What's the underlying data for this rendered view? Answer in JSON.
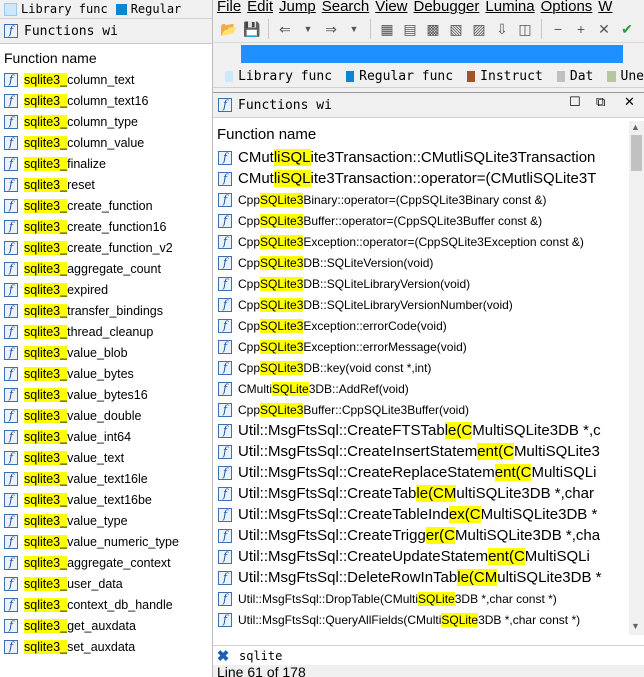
{
  "left": {
    "legend": [
      {
        "label": "Library func",
        "color": "#cce8ff"
      },
      {
        "label": "Regular",
        "color": "#0a86d6"
      }
    ],
    "tab_title": "Functions wi",
    "column_header": "Function name",
    "rows": [
      {
        "hl": "sqlite3_",
        "rest": "column_text"
      },
      {
        "hl": "sqlite3_",
        "rest": "column_text16"
      },
      {
        "hl": "sqlite3_",
        "rest": "column_type"
      },
      {
        "hl": "sqlite3_",
        "rest": "column_value"
      },
      {
        "hl": "sqlite3_",
        "rest": "finalize"
      },
      {
        "hl": "sqlite3_",
        "rest": "reset"
      },
      {
        "hl": "sqlite3_",
        "rest": "create_function"
      },
      {
        "hl": "sqlite3_",
        "rest": "create_function16"
      },
      {
        "hl": "sqlite3_",
        "rest": "create_function_v2"
      },
      {
        "hl": "sqlite3_",
        "rest": "aggregate_count"
      },
      {
        "hl": "sqlite3_",
        "rest": "expired"
      },
      {
        "hl": "sqlite3_",
        "rest": "transfer_bindings"
      },
      {
        "hl": "sqlite3_",
        "rest": "thread_cleanup"
      },
      {
        "hl": "sqlite3_",
        "rest": "value_blob"
      },
      {
        "hl": "sqlite3_",
        "rest": "value_bytes"
      },
      {
        "hl": "sqlite3_",
        "rest": "value_bytes16"
      },
      {
        "hl": "sqlite3_",
        "rest": "value_double"
      },
      {
        "hl": "sqlite3_",
        "rest": "value_int64"
      },
      {
        "hl": "sqlite3_",
        "rest": "value_text"
      },
      {
        "hl": "sqlite3_",
        "rest": "value_text16le"
      },
      {
        "hl": "sqlite3_",
        "rest": "value_text16be"
      },
      {
        "hl": "sqlite3_",
        "rest": "value_type"
      },
      {
        "hl": "sqlite3_",
        "rest": "value_numeric_type"
      },
      {
        "hl": "sqlite3_",
        "rest": "aggregate_context"
      },
      {
        "hl": "sqlite3_",
        "rest": "user_data"
      },
      {
        "hl": "sqlite3_",
        "rest": "context_db_handle"
      },
      {
        "hl": "sqlite3_",
        "rest": "get_auxdata"
      },
      {
        "hl": "sqlite3_",
        "rest": "set_auxdata"
      }
    ]
  },
  "right": {
    "menu": [
      "File",
      "Edit",
      "Jump",
      "Search",
      "View",
      "Debugger",
      "Lumina",
      "Options",
      "W"
    ],
    "toolbar_icons": [
      "open-icon",
      "save-icon",
      "back-icon",
      "forward-icon",
      "binary-icon",
      "code-icon",
      "data-icon",
      "struct-icon",
      "func-icon",
      "down-icon",
      "graph-icon",
      "minus-icon",
      "plus-icon",
      "close-icon",
      "check-icon"
    ],
    "legend": [
      {
        "label": "Library func",
        "color": "#cce8ff"
      },
      {
        "label": "Regular func",
        "color": "#0a86d6"
      },
      {
        "label": "Instruct",
        "color": "#a0522d"
      },
      {
        "label": "Dat",
        "color": "#c0c0c0"
      },
      {
        "label": "Une",
        "color": "#b5c79c"
      }
    ],
    "panel_title": "Functions wi",
    "column_header": "Function name",
    "rows": [
      {
        "size": "big",
        "parts": [
          [
            "CMut",
            false
          ],
          [
            "liSQL",
            true
          ],
          [
            "ite3Transaction::CMutliSQLite3Transaction",
            false
          ]
        ]
      },
      {
        "size": "big",
        "parts": [
          [
            "CMut",
            false
          ],
          [
            "liSQL",
            true
          ],
          [
            "ite3Transaction::operator=(CMutliSQLite3T",
            false
          ]
        ]
      },
      {
        "size": "small",
        "parts": [
          [
            "Cpp",
            false
          ],
          [
            "SQLite3",
            true
          ],
          [
            "Binary::operator=(CppSQLite3Binary const &)",
            false
          ]
        ]
      },
      {
        "size": "small",
        "parts": [
          [
            "Cpp",
            false
          ],
          [
            "SQLite3",
            true
          ],
          [
            "Buffer::operator=(CppSQLite3Buffer const &)",
            false
          ]
        ]
      },
      {
        "size": "small",
        "parts": [
          [
            "Cpp",
            false
          ],
          [
            "SQLite3",
            true
          ],
          [
            "Exception::operator=(CppSQLite3Exception const &)",
            false
          ]
        ]
      },
      {
        "size": "small",
        "parts": [
          [
            "Cpp",
            false
          ],
          [
            "SQLite3",
            true
          ],
          [
            "DB::SQLiteVersion(void)",
            false
          ]
        ]
      },
      {
        "size": "small",
        "parts": [
          [
            "Cpp",
            false
          ],
          [
            "SQLite3",
            true
          ],
          [
            "DB::SQLiteLibraryVersion(void)",
            false
          ]
        ]
      },
      {
        "size": "small",
        "parts": [
          [
            "Cpp",
            false
          ],
          [
            "SQLite3",
            true
          ],
          [
            "DB::SQLiteLibraryVersionNumber(void)",
            false
          ]
        ]
      },
      {
        "size": "small",
        "parts": [
          [
            "Cpp",
            false
          ],
          [
            "SQLite3",
            true
          ],
          [
            "Exception::errorCode(void)",
            false
          ]
        ]
      },
      {
        "size": "small",
        "parts": [
          [
            "Cpp",
            false
          ],
          [
            "SQLite3",
            true
          ],
          [
            "Exception::errorMessage(void)",
            false
          ]
        ]
      },
      {
        "size": "small",
        "parts": [
          [
            "Cpp",
            false
          ],
          [
            "SQLite3",
            true
          ],
          [
            "DB::key(void const *,int)",
            false
          ]
        ]
      },
      {
        "size": "small",
        "parts": [
          [
            "CMulti",
            false
          ],
          [
            "SQLite",
            true
          ],
          [
            "3DB::AddRef(void)",
            false
          ]
        ]
      },
      {
        "size": "small",
        "parts": [
          [
            "Cpp",
            false
          ],
          [
            "SQLite3",
            true
          ],
          [
            "Buffer::CppSQLite3Buffer(void)",
            false
          ]
        ]
      },
      {
        "size": "big",
        "parts": [
          [
            "Util::MsgFtsSql::CreateFTSTab",
            false
          ],
          [
            "le(C",
            true
          ],
          [
            "MultiSQLite3DB *,c",
            false
          ]
        ]
      },
      {
        "size": "big",
        "parts": [
          [
            "Util::MsgFtsSql::CreateInsertStatem",
            false
          ],
          [
            "ent(C",
            true
          ],
          [
            "MultiSQLite3",
            false
          ]
        ]
      },
      {
        "size": "big",
        "parts": [
          [
            "Util::MsgFtsSql::CreateReplaceStatem",
            false
          ],
          [
            "ent(C",
            true
          ],
          [
            "MultiSQLi",
            false
          ]
        ]
      },
      {
        "size": "big",
        "parts": [
          [
            "Util::MsgFtsSql::CreateTab",
            false
          ],
          [
            "le(CM",
            true
          ],
          [
            "ultiSQLite3DB *,char",
            false
          ]
        ]
      },
      {
        "size": "big",
        "parts": [
          [
            "Util::MsgFtsSql::CreateTableInd",
            false
          ],
          [
            "ex(C",
            true
          ],
          [
            "MultiSQLite3DB *",
            false
          ]
        ]
      },
      {
        "size": "big",
        "parts": [
          [
            "Util::MsgFtsSql::CreateTrigg",
            false
          ],
          [
            "er(C",
            true
          ],
          [
            "MultiSQLite3DB *,cha",
            false
          ]
        ]
      },
      {
        "size": "big",
        "parts": [
          [
            "Util::MsgFtsSql::CreateUpdateStatem",
            false
          ],
          [
            "ent(C",
            true
          ],
          [
            "MultiSQLi",
            false
          ]
        ]
      },
      {
        "size": "big",
        "parts": [
          [
            "Util::MsgFtsSql::DeleteRowInTab",
            false
          ],
          [
            "le(CM",
            true
          ],
          [
            "ultiSQLite3DB *",
            false
          ]
        ]
      },
      {
        "size": "small",
        "parts": [
          [
            "Util::MsgFtsSql::DropTable(CMulti",
            false
          ],
          [
            "SQLite",
            true
          ],
          [
            "3DB *,char const *)",
            false
          ]
        ]
      },
      {
        "size": "small",
        "parts": [
          [
            "Util::MsgFtsSql::QueryAllFields(CMulti",
            false
          ],
          [
            "SQLite",
            true
          ],
          [
            "3DB *,char const *)",
            false
          ]
        ]
      }
    ],
    "search_value": "sqlite",
    "status": "Line 61 of 178"
  },
  "colors": {
    "highlight": "#ffff00",
    "nav_blue": "#1e90ff",
    "icon_border": "#3b6fb3"
  }
}
